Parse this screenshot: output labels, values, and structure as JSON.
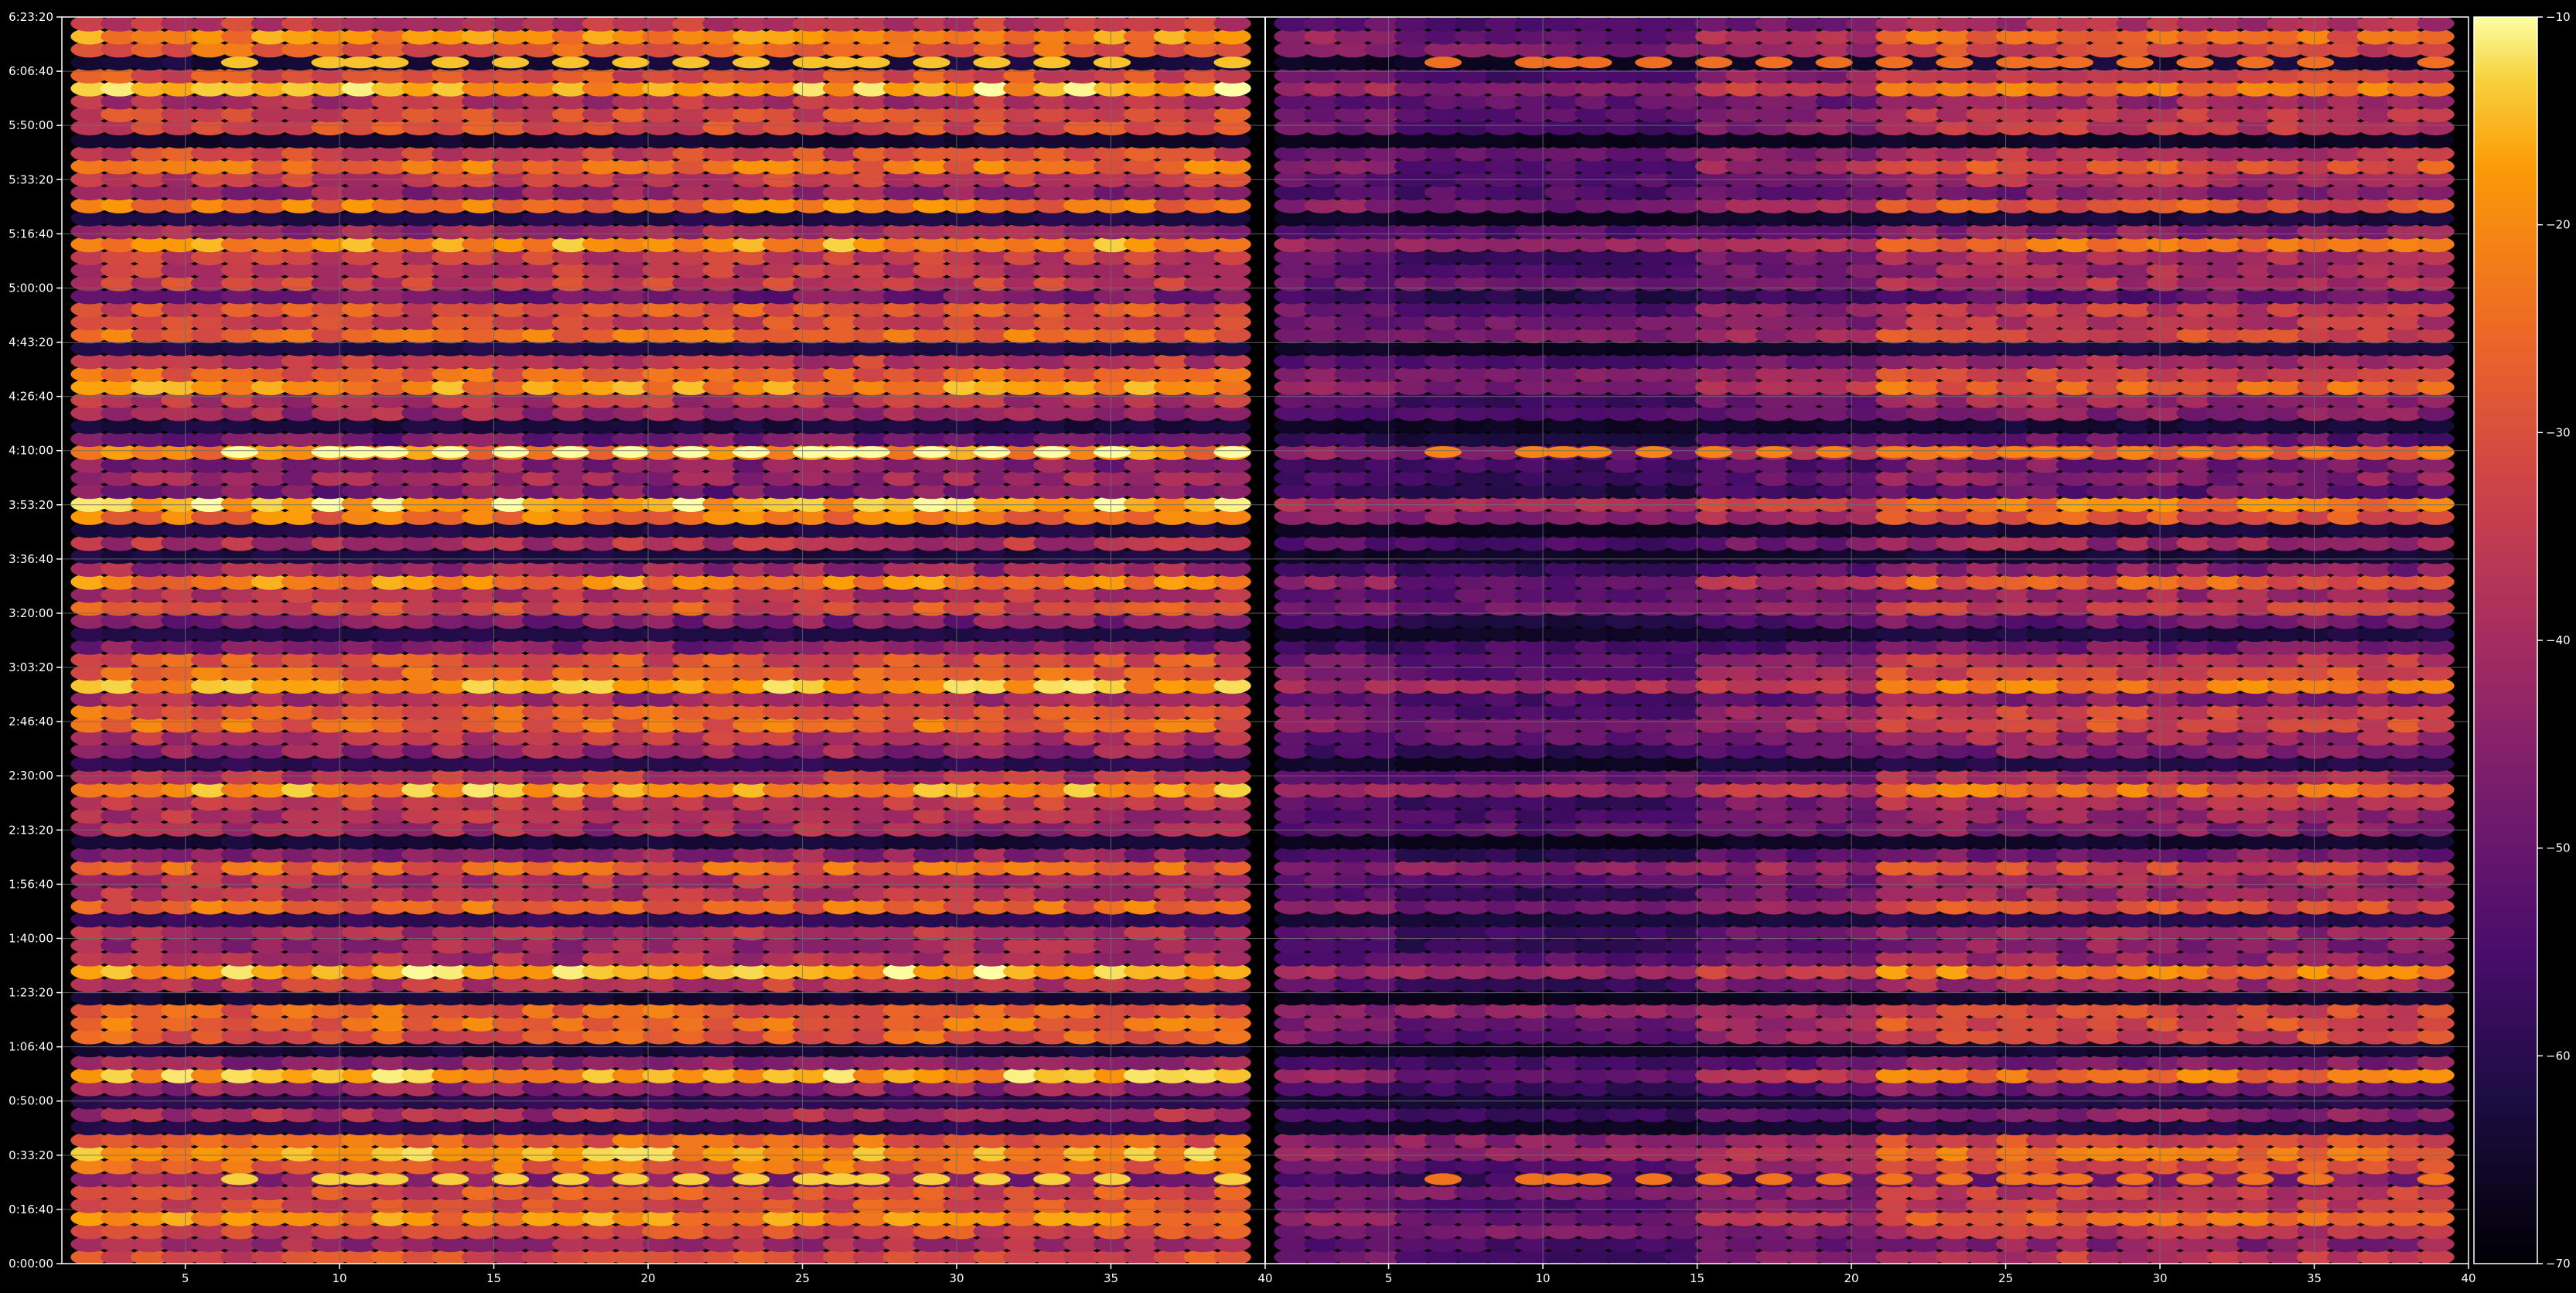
{
  "chart_data": {
    "type": "heatmap",
    "title": "",
    "xlabel": "",
    "ylabel": "",
    "background": "#000000",
    "grid": true,
    "grid_color": "#6e6e6e",
    "colormap": "inferno",
    "panels": [
      {
        "name": "",
        "xlim": [
          1,
          40
        ],
        "ylim": [
          0,
          23000
        ],
        "x_ticks": [
          5,
          10,
          15,
          20,
          25,
          30,
          35,
          40
        ],
        "x_tick_labels": [
          "5",
          "10",
          "15",
          "20",
          "25",
          "30",
          "35",
          "40"
        ]
      },
      {
        "name": "",
        "xlim": [
          1,
          40
        ],
        "ylim": [
          0,
          23000
        ],
        "x_ticks": [
          5,
          10,
          15,
          20,
          25,
          30,
          35,
          40
        ],
        "x_tick_labels": [
          "5",
          "10",
          "15",
          "20",
          "25",
          "30",
          "35",
          "40"
        ]
      }
    ],
    "y_ticks": [
      0,
      1000,
      2000,
      3000,
      4000,
      5000,
      6000,
      7000,
      8000,
      9000,
      10000,
      11000,
      12000,
      13000,
      14000,
      15000,
      16000,
      17000,
      18000,
      19000,
      20000,
      21000,
      22000,
      23000
    ],
    "y_tick_labels": [
      "0:00:00",
      "0:16:40",
      "0:33:20",
      "0:50:00",
      "1:06:40",
      "1:23:20",
      "1:40:00",
      "1:56:40",
      "2:13:20",
      "2:30:00",
      "2:46:40",
      "3:03:20",
      "3:20:00",
      "3:36:40",
      "3:53:20",
      "4:10:00",
      "4:26:40",
      "4:43:20",
      "5:00:00",
      "5:16:40",
      "5:33:20",
      "5:50:00",
      "6:06:40",
      "6:23:20"
    ],
    "colorbar": {
      "range": [
        -70,
        -10
      ],
      "ticks": [
        -70,
        -60,
        -50,
        -40,
        -30,
        -20,
        -10
      ],
      "tick_labels": [
        "−70",
        "−60",
        "−50",
        "−40",
        "−30",
        "−20",
        "−10"
      ]
    }
  }
}
